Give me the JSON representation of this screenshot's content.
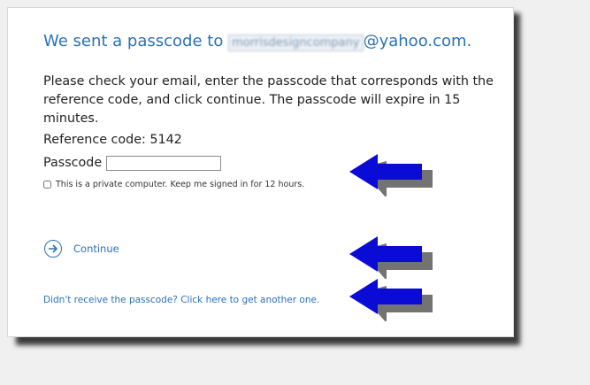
{
  "dialog": {
    "heading_prefix": "We sent a passcode to ",
    "email_user_blurred": "morrisdesigncompany",
    "email_domain": "@yahoo.com.",
    "description": "Please check your email, enter the passcode that corresponds with the reference code, and click continue. The passcode will expire in 15 minutes.",
    "reference_code": "Reference code: 5142",
    "passcode_label": "Passcode",
    "passcode_value": "",
    "keep_signed_in": "This is a private computer. Keep me signed in for 12 hours.",
    "keep_signed_in_checked": false,
    "continue_label": "Continue",
    "resend_link": "Didn't receive the passcode? Click here to get another one."
  },
  "annotations": {
    "arrow_icon": "left-arrow-icon",
    "arrow_color": "#0b0bd6"
  },
  "colors": {
    "link": "#2a72b5",
    "text": "#222222",
    "page_background": "#ffffff",
    "outer_background": "#f0f0f0"
  }
}
